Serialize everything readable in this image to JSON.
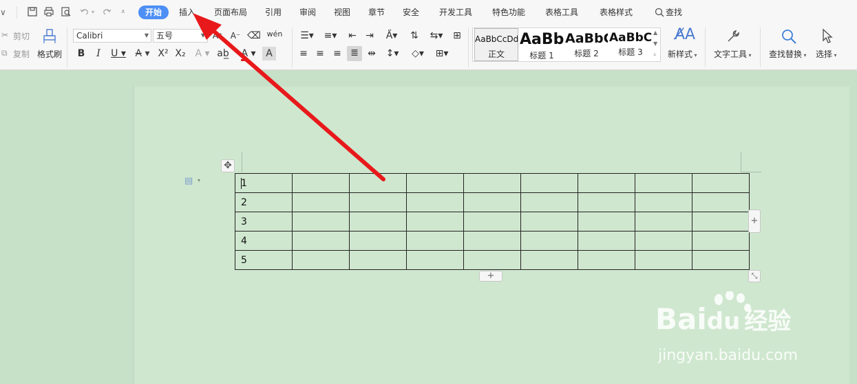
{
  "menubar": {
    "tabs": [
      "开始",
      "插入",
      "页面布局",
      "引用",
      "审阅",
      "视图",
      "章节",
      "安全",
      "开发工具",
      "特色功能",
      "表格工具",
      "表格样式"
    ],
    "search_label": "查找"
  },
  "ribbon": {
    "clipboard": {
      "cut": "剪切",
      "copy": "复制",
      "format_painter": "格式刷"
    },
    "font": {
      "name": "Calibri",
      "size": "五号"
    },
    "styles": [
      {
        "preview": "AaBbCcDd",
        "label": "正文"
      },
      {
        "preview": "AaBb",
        "label": "标题 1"
      },
      {
        "preview": "AaBbC",
        "label": "标题 2"
      },
      {
        "preview": "AaBbC",
        "label": "标题 3"
      }
    ],
    "new_style": "新样式",
    "text_tools": "文字工具",
    "find_replace": "查找替换",
    "select": "选择"
  },
  "document": {
    "table_rows": 5,
    "table_cols": 9,
    "first_column": [
      "1",
      "2",
      "3",
      "4",
      "5"
    ]
  },
  "colors": {
    "active_tab": "#4d8ff5",
    "doc_background": "#c7e0c8",
    "page": "#cfe7cf",
    "annotation_arrow": "#e8191b"
  },
  "watermark": {
    "brand": "Bai",
    "brand_suffix": "du",
    "brand_cn": "经验",
    "url": "jingyan.baidu.com"
  }
}
